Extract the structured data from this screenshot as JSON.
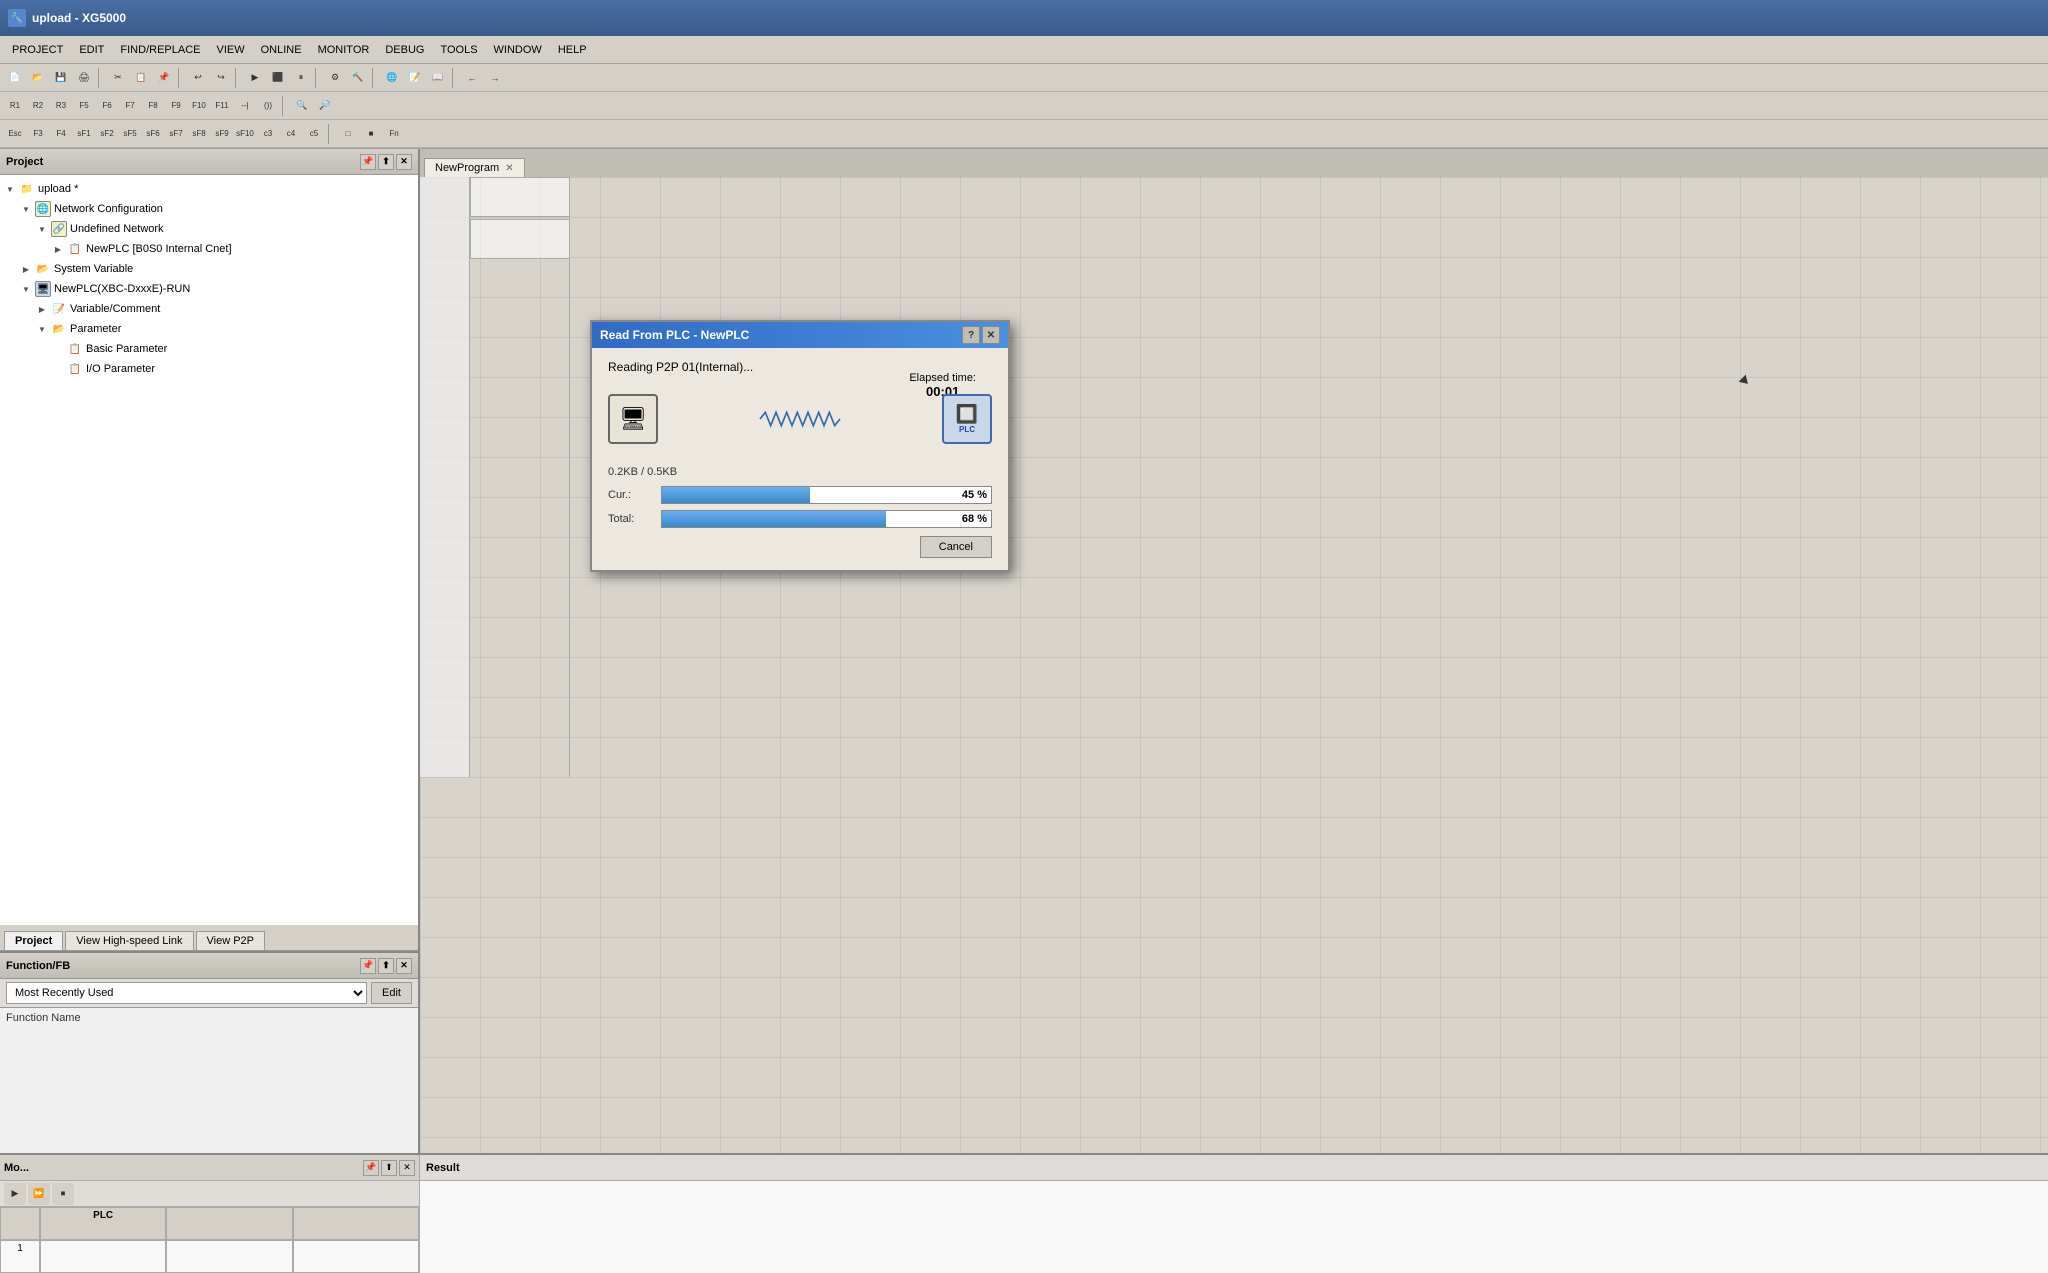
{
  "titleBar": {
    "title": "upload - XG5000",
    "icon": "🔧"
  },
  "menuBar": {
    "items": [
      "PROJECT",
      "EDIT",
      "FIND/REPLACE",
      "VIEW",
      "ONLINE",
      "MONITOR",
      "DEBUG",
      "TOOLS",
      "WINDOW",
      "HELP"
    ]
  },
  "project": {
    "panelTitle": "Project",
    "tabs": [
      "Project",
      "View High-speed Link",
      "View P2P"
    ],
    "tree": {
      "root": "upload *",
      "items": [
        {
          "label": "upload *",
          "level": 0,
          "expanded": true,
          "type": "root"
        },
        {
          "label": "Network Configuration",
          "level": 1,
          "expanded": true,
          "type": "network"
        },
        {
          "label": "Undefined Network",
          "level": 2,
          "expanded": true,
          "type": "network"
        },
        {
          "label": "NewPLC [B0S0 Internal Cnet]",
          "level": 3,
          "expanded": false,
          "type": "plc"
        },
        {
          "label": "System Variable",
          "level": 1,
          "expanded": false,
          "type": "folder"
        },
        {
          "label": "NewPLC(XBC-DxxxE)-RUN",
          "level": 1,
          "expanded": true,
          "type": "plc"
        },
        {
          "label": "Variable/Comment",
          "level": 2,
          "expanded": false,
          "type": "doc"
        },
        {
          "label": "Parameter",
          "level": 2,
          "expanded": true,
          "type": "folder"
        },
        {
          "label": "Basic Parameter",
          "level": 3,
          "expanded": false,
          "type": "doc"
        },
        {
          "label": "I/O Parameter",
          "level": 3,
          "expanded": false,
          "type": "doc"
        }
      ]
    }
  },
  "fbPanel": {
    "title": "Function/FB",
    "dropdownValue": "Most Recently Used",
    "editLabel": "Edit",
    "functionNameLabel": "Function Name"
  },
  "editor": {
    "tabs": [
      {
        "label": "NewProgram",
        "closeable": true
      }
    ]
  },
  "bottomPanel": {
    "tabs": [
      "Mo...",
      "Result"
    ],
    "monitorColumns": [
      "",
      "PLC",
      "",
      ""
    ],
    "resultLabel": "Result",
    "monitorRow": [
      "1",
      "",
      "",
      ""
    ]
  },
  "dialog": {
    "title": "Read From PLC - NewPLC",
    "helpBtn": "?",
    "closeBtn": "✕",
    "statusText": "Reading P2P 01(Internal)...",
    "elapsedLabel": "Elapsed time:",
    "elapsedValue": "00:01",
    "sizeInfo": "0.2KB / 0.5KB",
    "curLabel": "Cur.:",
    "curPercent": "45",
    "totalLabel": "Total:",
    "totalPercent": "68",
    "cancelLabel": "Cancel"
  }
}
